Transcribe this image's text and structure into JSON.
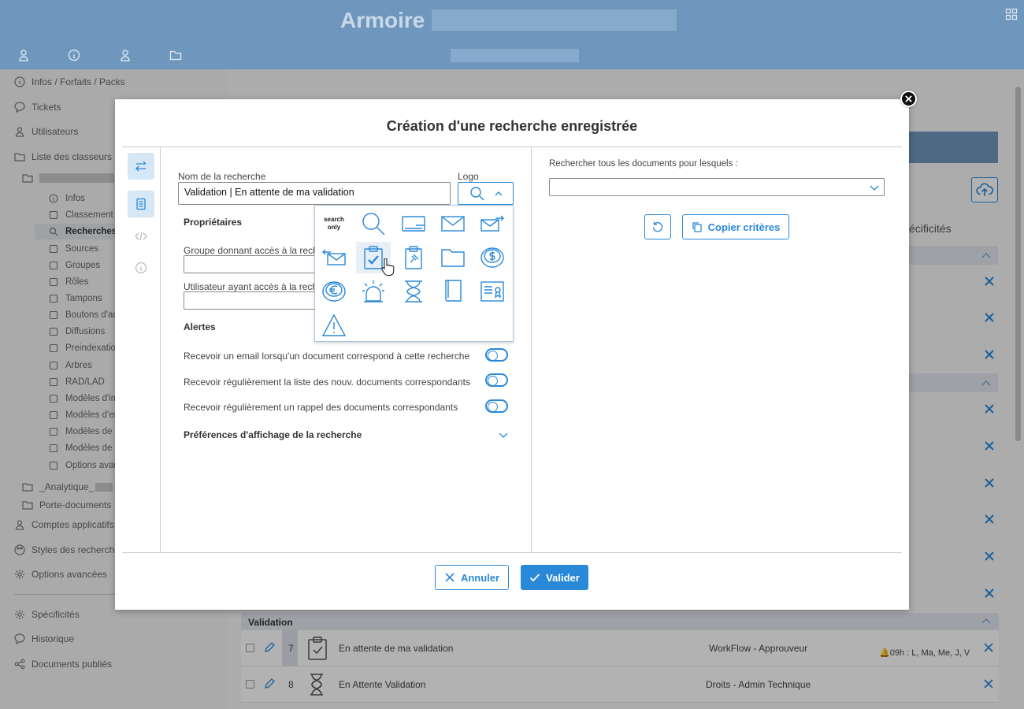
{
  "header": {
    "app_title": "Armoire",
    "icons": [
      "user-icon",
      "info-icon",
      "user-icon",
      "folder-icon",
      "grid-icon"
    ]
  },
  "sidebar": {
    "items": [
      {
        "label": "Infos / Forfaits / Packs",
        "icon": "info-icon"
      },
      {
        "label": "Tickets",
        "icon": "chat-icon"
      },
      {
        "label": "Utilisateurs",
        "icon": "user-icon"
      },
      {
        "label": "Liste des classeurs",
        "icon": "folder-icon"
      }
    ],
    "sub_items": [
      {
        "label": "Infos",
        "icon": "info-icon"
      },
      {
        "label": "Classement",
        "icon": "list-icon"
      },
      {
        "label": "Recherches",
        "icon": "search-icon"
      },
      {
        "label": "Sources",
        "icon": "source-icon"
      },
      {
        "label": "Groupes",
        "icon": "group-icon"
      },
      {
        "label": "Rôles",
        "icon": "role-icon"
      },
      {
        "label": "Tampons",
        "icon": "stamp-icon"
      },
      {
        "label": "Boutons d'ac",
        "icon": "button-icon"
      },
      {
        "label": "Diffusions",
        "icon": "share-icon"
      },
      {
        "label": "Preindexation",
        "icon": "index-icon"
      },
      {
        "label": "Arbres",
        "icon": "tree-icon"
      },
      {
        "label": "RAD/LAD",
        "icon": "doc-icon"
      },
      {
        "label": "Modèles d'im",
        "icon": "template-icon"
      },
      {
        "label": "Modèles d'en",
        "icon": "mail-icon"
      },
      {
        "label": "Modèles de s",
        "icon": "wand-icon"
      },
      {
        "label": "Modèles de c",
        "icon": "doc-icon"
      },
      {
        "label": "Options avan",
        "icon": "gear-icon"
      }
    ],
    "lower_items": [
      {
        "label": "_Analytique_",
        "icon": "folder-icon"
      },
      {
        "label": "Porte-documents",
        "icon": "folder-icon"
      },
      {
        "label": "Comptes applicatifs",
        "icon": "user-icon"
      },
      {
        "label": "Styles des recherches",
        "icon": "palette-icon"
      },
      {
        "label": "Options avancées",
        "icon": "gear-icon"
      },
      {
        "label": "Spécificités",
        "icon": "gear-icon"
      },
      {
        "label": "Historique",
        "icon": "chat-icon"
      },
      {
        "label": "Documents publiés",
        "icon": "share-icon"
      }
    ]
  },
  "background": {
    "column_header": "écificités",
    "group_label": "Validation",
    "rows": [
      {
        "num": "7",
        "name": "En attente de ma validation",
        "role": "WorkFlow - Approuveur",
        "alert": "09h : L, Ma, Me, J, V"
      },
      {
        "num": "8",
        "name": "En Attente Validation",
        "role": "Droits - Admin Technique",
        "alert": ""
      }
    ]
  },
  "modal": {
    "title": "Création d'une recherche enregistrée",
    "name_label": "Nom de la recherche",
    "name_value": "Validation | En attente de ma validation",
    "logo_label": "Logo",
    "owners_heading": "Propriétaires",
    "group_access_label": "Groupe donnant accès à la recherche",
    "user_access_label": "Utilisateur ayant accès à la recherche",
    "alerts_heading": "Alertes",
    "alert_options": [
      "Recevoir un email lorsqu'un document correspond à cette recherche",
      "Recevoir régulièrement la liste des nouv. documents correspondants",
      "Recevoir régulièrement un rappel des documents correspondants"
    ],
    "display_prefs": "Préférences d'affichage de la recherche",
    "criteria_label": "Rechercher tous les documents pour lesquels :",
    "copy_criteria": "Copier critères",
    "cancel": "Annuler",
    "validate": "Valider",
    "picker": {
      "search_only": "search only",
      "icons": [
        "search-icon",
        "wallet-icon",
        "envelope-icon",
        "envelope-send-icon",
        "envelope-receive-icon",
        "clipboard-check-icon",
        "clipboard-pin-icon",
        "folder-icon",
        "dollar-coin-icon",
        "euro-coin-icon",
        "alarm-icon",
        "hourglass-icon",
        "book-icon",
        "certificate-icon",
        "warning-icon"
      ],
      "selected": "clipboard-check-icon"
    }
  },
  "colors": {
    "accent": "#2a88d8",
    "header": "#6f97bd"
  }
}
